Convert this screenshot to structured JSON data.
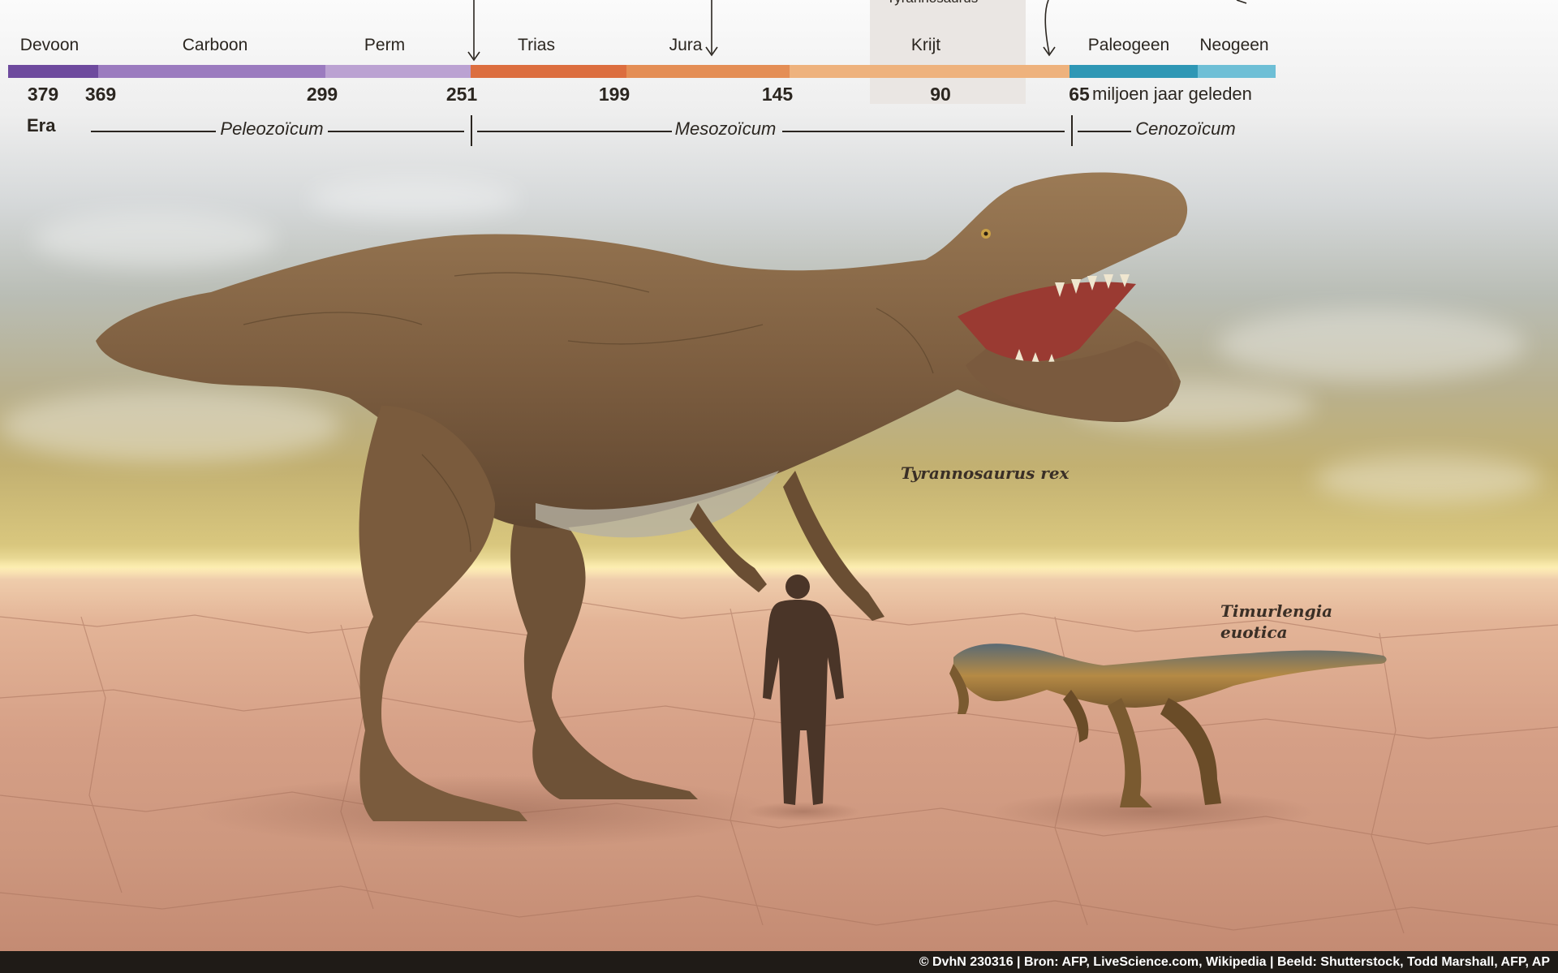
{
  "timeline": {
    "periods": [
      {
        "label": "Devoon",
        "color": "#6e4a9e"
      },
      {
        "label": "Carboon",
        "color": "#9b7bbf"
      },
      {
        "label": "Perm",
        "color": "#bba2d2"
      },
      {
        "label": "Trias",
        "color": "#dc6e3f"
      },
      {
        "label": "Jura",
        "color": "#e48e55"
      },
      {
        "label": "Krijt",
        "color": "#eeb27d"
      },
      {
        "label": "Paleogeen",
        "color": "#2e97b5"
      },
      {
        "label": "Neogeen",
        "color": "#6ebfd6"
      }
    ],
    "ages": [
      "379",
      "369",
      "299",
      "251",
      "199",
      "145",
      "90",
      "65"
    ],
    "unit_label": "miljoen jaar geleden",
    "era_title": "Era",
    "eras": [
      "Peleozoïcum",
      "Mesozoïcum",
      "Cenozoïcum"
    ],
    "highlight_label": "Tyrannosaurus"
  },
  "species": {
    "trex": "Tyrannosaurus rex",
    "timurlengia_line1": "Timurlengia",
    "timurlengia_line2": "euotica"
  },
  "footer": {
    "credit": "© DvhN 230316 | Bron: AFP, LiveScience.com, Wikipedia | Beeld: Shutterstock, Todd Marshall, AFP, AP"
  },
  "colors": {
    "sky_top": "#fbfbfb",
    "horizon": "#f4e5a4",
    "ground": "#d59f86",
    "trex_body": "#8a6a48",
    "silhouette": "#4a3528",
    "footer_bg": "#1f1b17"
  },
  "icons": {
    "trex": "tyrannosaurus-illustration",
    "small_dino": "timurlengia-illustration",
    "human": "human-silhouette"
  }
}
